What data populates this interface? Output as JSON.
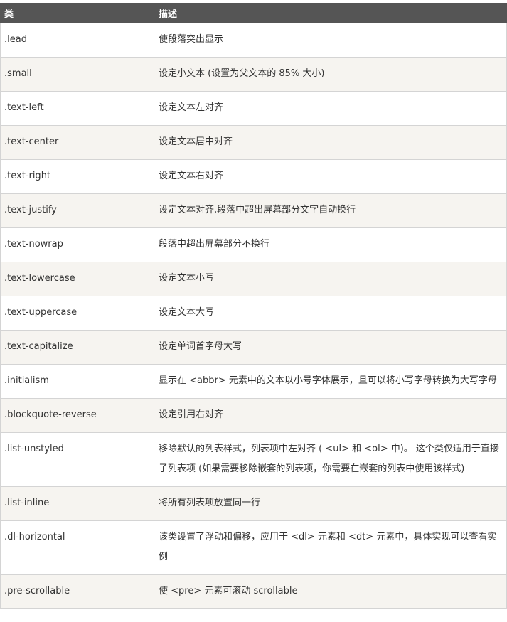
{
  "table": {
    "headers": [
      "类",
      "描述"
    ],
    "rows": [
      {
        "cls": ".lead",
        "desc": "使段落突出显示"
      },
      {
        "cls": ".small",
        "desc": "设定小文本 (设置为父文本的 85% 大小)"
      },
      {
        "cls": ".text-left",
        "desc": "设定文本左对齐"
      },
      {
        "cls": ".text-center",
        "desc": "设定文本居中对齐"
      },
      {
        "cls": ".text-right",
        "desc": "设定文本右对齐"
      },
      {
        "cls": ".text-justify",
        "desc": "设定文本对齐,段落中超出屏幕部分文字自动换行"
      },
      {
        "cls": ".text-nowrap",
        "desc": "段落中超出屏幕部分不换行"
      },
      {
        "cls": ".text-lowercase",
        "desc": "设定文本小写"
      },
      {
        "cls": ".text-uppercase",
        "desc": "设定文本大写"
      },
      {
        "cls": ".text-capitalize",
        "desc": "设定单词首字母大写"
      },
      {
        "cls": ".initialism",
        "desc": "显示在 <abbr> 元素中的文本以小号字体展示，且可以将小写字母转换为大写字母"
      },
      {
        "cls": ".blockquote-reverse",
        "desc": "设定引用右对齐"
      },
      {
        "cls": ".list-unstyled",
        "desc": "移除默认的列表样式，列表项中左对齐 ( <ul> 和 <ol> 中)。 这个类仅适用于直接子列表项 (如果需要移除嵌套的列表项，你需要在嵌套的列表中使用该样式)"
      },
      {
        "cls": ".list-inline",
        "desc": "将所有列表项放置同一行"
      },
      {
        "cls": ".dl-horizontal",
        "desc": "该类设置了浮动和偏移，应用于 <dl> 元素和 <dt> 元素中，具体实现可以查看实例"
      },
      {
        "cls": ".pre-scrollable",
        "desc": "使 <pre> 元素可滚动 scrollable"
      }
    ]
  }
}
